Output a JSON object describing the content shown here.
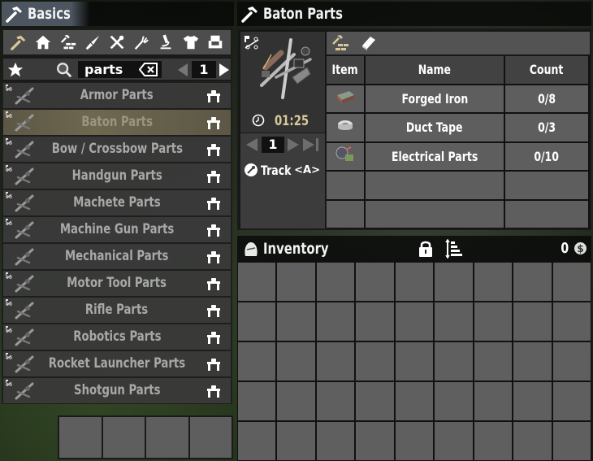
{
  "crafting": {
    "title": "Basics",
    "categories": [
      {
        "name": "basics",
        "icon": "hammer-icon",
        "active": true
      },
      {
        "name": "building",
        "icon": "house-icon",
        "active": false
      },
      {
        "name": "workstations",
        "icon": "hammer-bricks-icon",
        "active": false
      },
      {
        "name": "weapons",
        "icon": "knife-icon",
        "active": false
      },
      {
        "name": "tools",
        "icon": "wrench-screwdriver-icon",
        "active": false
      },
      {
        "name": "food",
        "icon": "fork-icon",
        "active": false
      },
      {
        "name": "science",
        "icon": "microscope-icon",
        "active": false
      },
      {
        "name": "clothing",
        "icon": "shirt-icon",
        "active": false
      },
      {
        "name": "decor",
        "icon": "armchair-icon",
        "active": false
      }
    ],
    "search": {
      "value": "parts",
      "placeholder": ""
    },
    "page": "1",
    "recipes": [
      {
        "label": "Armor Parts",
        "locked": true,
        "selected": false
      },
      {
        "label": "Baton Parts",
        "locked": true,
        "selected": true
      },
      {
        "label": "Bow / Crossbow Parts",
        "locked": true,
        "selected": false
      },
      {
        "label": "Handgun Parts",
        "locked": true,
        "selected": false
      },
      {
        "label": "Machete Parts",
        "locked": true,
        "selected": false
      },
      {
        "label": "Machine Gun Parts",
        "locked": true,
        "selected": false
      },
      {
        "label": "Mechanical Parts",
        "locked": false,
        "selected": false
      },
      {
        "label": "Motor Tool Parts",
        "locked": true,
        "selected": false
      },
      {
        "label": "Rifle Parts",
        "locked": true,
        "selected": false
      },
      {
        "label": "Robotics Parts",
        "locked": true,
        "selected": false
      },
      {
        "label": "Rocket Launcher Parts",
        "locked": true,
        "selected": false
      },
      {
        "label": "Shotgun Parts",
        "locked": true,
        "selected": false
      }
    ],
    "queue_slots": 4
  },
  "recipe": {
    "title": "Baton Parts",
    "craft_time": "01:25",
    "quantity": "1",
    "track_label": "Track",
    "track_key": "<A>",
    "columns": {
      "item": "Item",
      "name": "Name",
      "count": "Count"
    },
    "ingredients": [
      {
        "name": "Forged Iron",
        "count": "0/8",
        "icon": "forged-iron-icon"
      },
      {
        "name": "Duct Tape",
        "count": "0/3",
        "icon": "duct-tape-icon"
      },
      {
        "name": "Electrical Parts",
        "count": "0/10",
        "icon": "electrical-parts-icon"
      },
      {
        "name": "",
        "count": "",
        "icon": ""
      },
      {
        "name": "",
        "count": "",
        "icon": ""
      }
    ]
  },
  "inventory": {
    "title": "Inventory",
    "currency": "0",
    "rows": 5,
    "cols": 9
  },
  "colors": {
    "accent_gold": "#d9c99a",
    "selected_row": "#6e6850",
    "panel": "#3a3a3a",
    "slot": "#5f5f5f"
  }
}
